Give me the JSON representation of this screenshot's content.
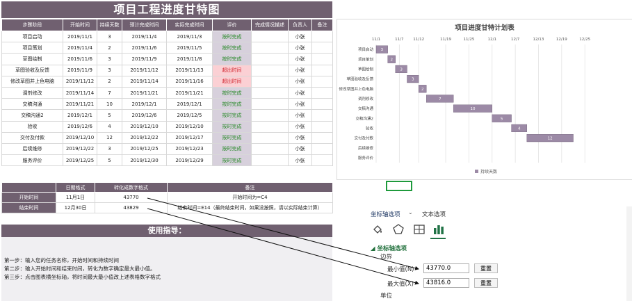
{
  "title": "项目工程进度甘特图",
  "table": {
    "headers": [
      "步骤阶段",
      "开始时间",
      "持续天数",
      "预计完成时间",
      "实际完成时间",
      "评价",
      "完成情况描述",
      "负责人",
      "备注"
    ],
    "rows": [
      {
        "step": "项目启动",
        "start": "2019/11/1",
        "days": "3",
        "plan_end": "2019/11/4",
        "actual_end": "2019/11/3",
        "eval": "按时完成",
        "desc": "",
        "owner": "小张",
        "note": ""
      },
      {
        "step": "项目策划",
        "start": "2019/11/4",
        "days": "2",
        "plan_end": "2019/11/6",
        "actual_end": "2019/11/5",
        "eval": "按时完成",
        "desc": "",
        "owner": "小张",
        "note": ""
      },
      {
        "step": "草图绘制",
        "start": "2019/11/6",
        "days": "3",
        "plan_end": "2019/11/9",
        "actual_end": "2019/11/8",
        "eval": "按时完成",
        "desc": "",
        "owner": "小张",
        "note": ""
      },
      {
        "step": "草图验收及反馈",
        "start": "2019/11/9",
        "days": "3",
        "plan_end": "2019/11/12",
        "actual_end": "2019/11/13",
        "eval": "超出时间",
        "desc": "",
        "owner": "小张",
        "note": ""
      },
      {
        "step": "修改草图并上色电脑",
        "start": "2019/11/12",
        "days": "2",
        "plan_end": "2019/11/14",
        "actual_end": "2019/11/16",
        "eval": "超出时间",
        "desc": "",
        "owner": "小张",
        "note": ""
      },
      {
        "step": "调剂修改",
        "start": "2019/11/14",
        "days": "7",
        "plan_end": "2019/11/21",
        "actual_end": "2019/11/21",
        "eval": "按时完成",
        "desc": "",
        "owner": "小张",
        "note": ""
      },
      {
        "step": "交稿沟通",
        "start": "2019/11/21",
        "days": "10",
        "plan_end": "2019/12/1",
        "actual_end": "2019/12/1",
        "eval": "按时完成",
        "desc": "",
        "owner": "小张",
        "note": ""
      },
      {
        "step": "交稿沟通2",
        "start": "2019/12/1",
        "days": "5",
        "plan_end": "2019/12/6",
        "actual_end": "2019/12/5",
        "eval": "按时完成",
        "desc": "",
        "owner": "小张",
        "note": ""
      },
      {
        "step": "验收",
        "start": "2019/12/6",
        "days": "4",
        "plan_end": "2019/12/10",
        "actual_end": "2019/12/10",
        "eval": "按时完成",
        "desc": "",
        "owner": "小张",
        "note": ""
      },
      {
        "step": "交付及付款",
        "start": "2019/12/10",
        "days": "12",
        "plan_end": "2019/12/22",
        "actual_end": "2019/12/17",
        "eval": "按时完成",
        "desc": "",
        "owner": "小张",
        "note": ""
      },
      {
        "step": "后续维修",
        "start": "2019/12/22",
        "days": "3",
        "plan_end": "2019/12/25",
        "actual_end": "2019/12/23",
        "eval": "按时完成",
        "desc": "",
        "owner": "小张",
        "note": ""
      },
      {
        "step": "服务评价",
        "start": "2019/12/25",
        "days": "5",
        "plan_end": "2019/12/30",
        "actual_end": "2019/12/29",
        "eval": "按时完成",
        "desc": "",
        "owner": "小张",
        "note": ""
      }
    ]
  },
  "chart_data": {
    "type": "bar",
    "title": "项目进度甘特计划表",
    "orientation": "horizontal-stacked-gantt",
    "categories": [
      "项目启动",
      "项目策划",
      "草图绘制",
      "草图验收及反馈",
      "修改草图并上色电脑",
      "调剂修改",
      "交稿沟通",
      "交稿沟通2",
      "验收",
      "交付及付款",
      "后续维修",
      "服务评价"
    ],
    "x_ticks": [
      "11/1",
      "11/7",
      "11/12",
      "11/19",
      "11/25",
      "12/1",
      "12/7",
      "12/13",
      "12/19",
      "12/25"
    ],
    "x_tick_values": [
      43770,
      43776,
      43781,
      43788,
      43794,
      43800,
      43806,
      43812,
      43818,
      43824
    ],
    "xlim": [
      43770,
      43829
    ],
    "start_values": [
      43770,
      43773,
      43775,
      43778,
      43781,
      43783,
      43790,
      43800,
      43805,
      43809
    ],
    "series": [
      {
        "name": "持续天数",
        "values": [
          3,
          2,
          3,
          3,
          2,
          7,
          10,
          5,
          4,
          12
        ]
      }
    ],
    "legend": "bottom",
    "grid": true,
    "bar_color": "#9c8aa6"
  },
  "date_table": {
    "headers": [
      "",
      "日期格式",
      "转化成数字格式",
      "备注"
    ],
    "rows": [
      {
        "label": "开始时间",
        "date": "11月1日",
        "num": "43770",
        "note": "开始时间为=C4"
      },
      {
        "label": "结束时间",
        "date": "12月30日",
        "num": "43829",
        "note": "结束时间=E14（最终结束时间，如果没按照，请以实际结束计算）"
      }
    ]
  },
  "guide": {
    "title": "使用指导：",
    "steps": [
      "第一步：输入您的任务名称，开始时间和持续时间",
      "第二步：输入开始时间和结束时间，转化为数字确定最大最小值。",
      "第三步：点击图表横坐标轴，将时间最大最小值改上述表格数字格式"
    ]
  },
  "pane": {
    "tab_axis": "坐标轴选项",
    "tab_text": "文本选项",
    "section": "坐标轴选项",
    "bounds": "边界",
    "min_label": "最小值(N)",
    "min_value": "43770.0",
    "max_label": "最大值(X)",
    "max_value": "43816.0",
    "reset": "重置",
    "unit": "单位"
  },
  "colors": {
    "header": "#706070",
    "ok_fill": "#d7d0dc",
    "late_fill": "#fbd0d4",
    "ok_text": "#2a8a2a",
    "late_text": "#d0202a",
    "accent": "#217346"
  }
}
